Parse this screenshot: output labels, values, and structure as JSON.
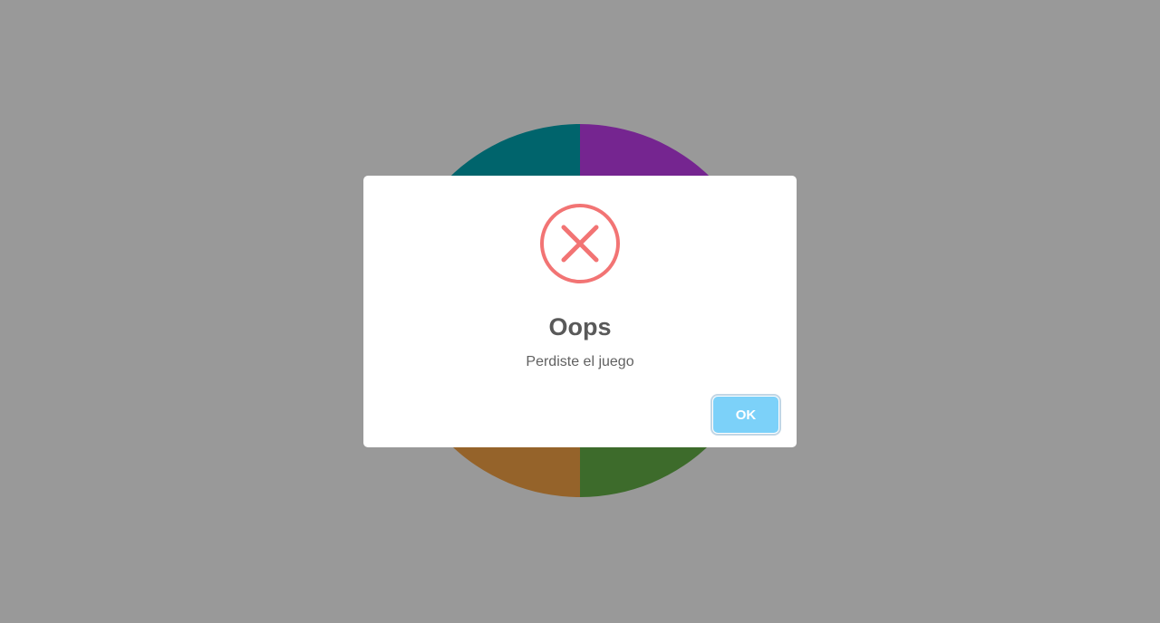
{
  "board": {
    "quadrants": [
      {
        "name": "top-left",
        "color": "#00a7b5"
      },
      {
        "name": "top-right",
        "color": "#c43ff0"
      },
      {
        "name": "bottom-left",
        "color": "#f8a647"
      },
      {
        "name": "bottom-right",
        "color": "#66b349"
      }
    ]
  },
  "modal": {
    "icon": "error-x-icon",
    "icon_color": "#f27474",
    "title": "Oops",
    "text": "Perdiste el juego",
    "ok_label": "OK",
    "ok_color": "#7cd1f9"
  }
}
